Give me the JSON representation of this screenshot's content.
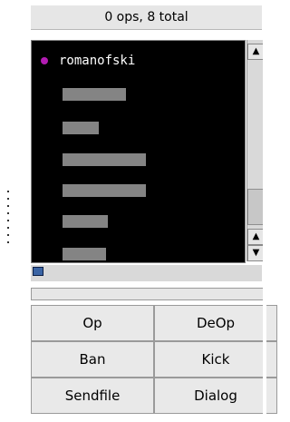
{
  "status": "0 ops, 8 total",
  "users": [
    {
      "nick": "romanofski",
      "mode_color": "#b21cb2"
    }
  ],
  "scroll": {
    "up": "▲",
    "down": "▼"
  },
  "buttons": {
    "op": "Op",
    "deop": "DeOp",
    "ban": "Ban",
    "kick": "Kick",
    "sendfile": "Sendfile",
    "dialog": "Dialog"
  }
}
